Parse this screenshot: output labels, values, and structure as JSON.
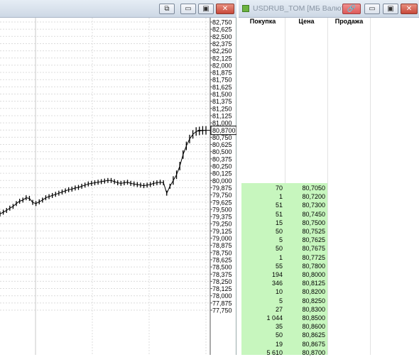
{
  "chart_window": {
    "buttons": {
      "restore": "⧉",
      "minimize": "▭",
      "maximize": "▣",
      "close": "✕"
    },
    "price_axis": [
      "82,750",
      "82,625",
      "82,500",
      "82,375",
      "82,250",
      "82,125",
      "82,000",
      "81,875",
      "81,750",
      "81,625",
      "81,500",
      "81,375",
      "81,250",
      "81,125",
      "81,000",
      "80,875",
      "80,750",
      "80,625",
      "80,500",
      "80,375",
      "80,250",
      "80,125",
      "80,000",
      "79,875",
      "79,750",
      "79,625",
      "79,500",
      "79,375",
      "79,250",
      "79,125",
      "79,000",
      "78,875",
      "78,750",
      "78,625",
      "78,500",
      "78,375",
      "78,250",
      "78,125",
      "78,000",
      "77,875",
      "77,750"
    ],
    "current_price": "80,8700"
  },
  "chart_data": {
    "type": "line",
    "title": "",
    "xlabel": "",
    "ylabel": "",
    "ylim": [
      77.75,
      82.8
    ],
    "current_price": 80.87,
    "series": [
      {
        "values": [
          79.42,
          79.45,
          79.48,
          79.52,
          79.55,
          79.6,
          79.64,
          79.66,
          79.7,
          79.69,
          79.62,
          79.6,
          79.63,
          79.66,
          79.7,
          79.72,
          79.74,
          79.76,
          79.78,
          79.8,
          79.82,
          79.84,
          79.85,
          79.87,
          79.88,
          79.9,
          79.92,
          79.94,
          79.95,
          79.96,
          79.97,
          79.98,
          79.99,
          80.0,
          80.0,
          79.98,
          79.96,
          79.95,
          79.96,
          79.97,
          79.95,
          79.94,
          79.93,
          79.92,
          79.91,
          79.92,
          79.93,
          79.95,
          79.96,
          79.97,
          79.96,
          79.78,
          79.9,
          80.0,
          80.1,
          80.25,
          80.45,
          80.6,
          80.72,
          80.8,
          80.85,
          80.86,
          80.87,
          80.87
        ]
      }
    ]
  },
  "orderbook_window": {
    "title": "USDRUB_TOM [МБ Валюта: ЕТС",
    "buttons": {
      "pin": "🔗",
      "minimize": "▭",
      "maximize": "▣",
      "close": "✕"
    },
    "columns": {
      "buy": "Покупка",
      "price": "Цена",
      "sell": "Продажа"
    },
    "rows": [
      {
        "buy": "70",
        "price": "80,7050"
      },
      {
        "buy": "1",
        "price": "80,7200"
      },
      {
        "buy": "51",
        "price": "80,7300"
      },
      {
        "buy": "51",
        "price": "80,7450"
      },
      {
        "buy": "15",
        "price": "80,7500"
      },
      {
        "buy": "50",
        "price": "80,7525"
      },
      {
        "buy": "5",
        "price": "80,7625"
      },
      {
        "buy": "50",
        "price": "80,7675"
      },
      {
        "buy": "1",
        "price": "80,7725"
      },
      {
        "buy": "55",
        "price": "80,7800"
      },
      {
        "buy": "194",
        "price": "80,8000"
      },
      {
        "buy": "346",
        "price": "80,8125"
      },
      {
        "buy": "10",
        "price": "80,8200"
      },
      {
        "buy": "5",
        "price": "80,8250"
      },
      {
        "buy": "27",
        "price": "80,8300"
      },
      {
        "buy": "1 044",
        "price": "80,8500"
      },
      {
        "buy": "35",
        "price": "80,8600"
      },
      {
        "buy": "50",
        "price": "80,8625"
      },
      {
        "buy": "19",
        "price": "80,8675"
      },
      {
        "buy": "5 610",
        "price": "80,8700"
      }
    ],
    "colors": {
      "bid_bg": "#c7f6be"
    }
  }
}
